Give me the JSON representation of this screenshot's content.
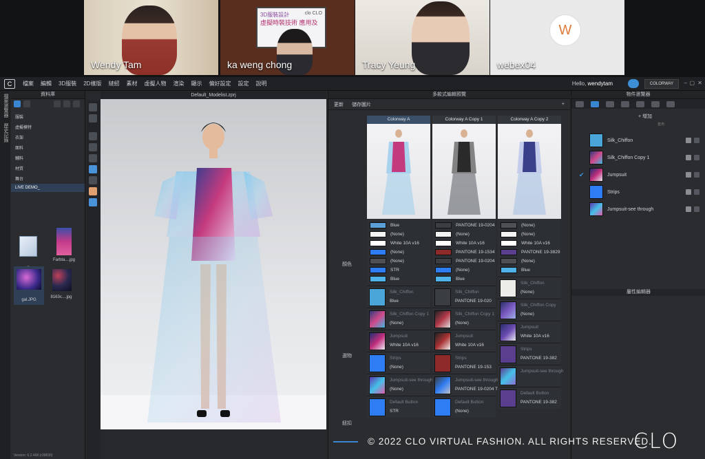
{
  "meeting": {
    "participants": [
      {
        "name": "Wendy Tam"
      },
      {
        "name": "ka weng chong",
        "slide": {
          "title": "3D服裝設計",
          "subtitle": "虛擬時裝技術 應用及",
          "logo": "clo CLO"
        }
      },
      {
        "name": "Tracy Yeung"
      },
      {
        "name": "webex04",
        "initial": "W"
      }
    ]
  },
  "app": {
    "logo": "C",
    "menu": [
      "檔案",
      "編輯",
      "3D服裝",
      "2D樣版",
      "縫紉",
      "素材",
      "虛擬人物",
      "渲染",
      "顯示",
      "偏好設定",
      "設定",
      "說明"
    ],
    "greeting_prefix": "Hello, ",
    "username": "wendytam",
    "colorway_tab": "COLORWAY",
    "window_controls": [
      "–",
      "▢",
      "✕"
    ],
    "version": "Version: 6.2.468 (r39830)"
  },
  "left_tabs": [
    "檔案瀏覽器",
    "歷史記錄"
  ],
  "library": {
    "title": "資料庫",
    "items": [
      "服裝",
      "虛擬模特",
      "衣架",
      "面料",
      "輔料",
      "材質",
      "舞台",
      "LIVE DEMO_"
    ],
    "selected_index": 7,
    "files": [
      {
        "label": "..",
        "kind": "folder"
      },
      {
        "label": "Farbta....jpg"
      },
      {
        "label": "gal.JPG"
      },
      {
        "label": "8163c....jpg"
      }
    ]
  },
  "viewport": {
    "title": "Default_Modelist.zprj"
  },
  "editor": {
    "title": "多款式編輯預覽",
    "toolbar": [
      "更新",
      "儲存圖片"
    ],
    "plus": "+",
    "row_labels": {
      "color": "顏色",
      "fabric": "選物",
      "trim": "鈕扣"
    },
    "columns": [
      {
        "name": "Colorway A",
        "swatches": [
          {
            "color": "#5aa0d6",
            "label": "Blue"
          },
          {
            "color": "#f4f4f4",
            "label": "(None)"
          },
          {
            "color": "#ffffff",
            "label": "White 10A v16"
          },
          {
            "color": "#2f7df4",
            "label": "(None)"
          },
          {
            "color": "#4d5156",
            "label": "(None)"
          },
          {
            "color": "#2f7df4",
            "label": "STR"
          },
          {
            "color": "#4fb2e8",
            "label": "Blue"
          }
        ],
        "fabrics": [
          {
            "color": "#4aa6d8",
            "name": "Silk_Chiffon",
            "value": "Blue"
          },
          {
            "color": "linear-gradient(135deg,#2e3a7a,#d04a8a,#3fb5e0)",
            "name": "Silk_Chiffon Copy 1",
            "value": "(None)"
          },
          {
            "color": "linear-gradient(135deg,#1f2f70,#c02e7c,#e9e9f2)",
            "name": "Jumpsuit",
            "value": "White 10A v16"
          },
          {
            "color": "#2f7df4",
            "name": "Strips",
            "value": "(None)"
          },
          {
            "color": "linear-gradient(135deg,#5a3ab0,#46c0e8,#e05aa8)",
            "name": "Jumpsuit-see through",
            "value": "(None)"
          },
          {
            "color": "#2f7df4",
            "name": "Default Button",
            "value": "STR"
          }
        ]
      },
      {
        "name": "Colorway A Copy 1",
        "swatches": [
          {
            "color": "#3a3d42",
            "label": "PANTONE 19-0204"
          },
          {
            "color": "#f4f4f4",
            "label": "(None)"
          },
          {
            "color": "#ffffff",
            "label": "White 10A v16"
          },
          {
            "color": "#8e2a2a",
            "label": "PANTONE 19-1534"
          },
          {
            "color": "#3a3d42",
            "label": "PANTONE 19-0204"
          },
          {
            "color": "#2f7df4",
            "label": "(None)"
          },
          {
            "color": "#4fb2e8",
            "label": "Blue"
          }
        ],
        "fabrics": [
          {
            "color": "#3a3d42",
            "name": "Silk_Chiffon",
            "value": "PANTONE 19-020"
          },
          {
            "color": "linear-gradient(135deg,#222,#b23a4a,#ddd)",
            "name": "Silk_Chiffon Copy 1",
            "value": "(None)"
          },
          {
            "color": "linear-gradient(135deg,#222,#a33,#eee)",
            "name": "Jumpsuit",
            "value": "White 10A v16"
          },
          {
            "color": "#8e2a2a",
            "name": "Strips",
            "value": "PANTONE 19-153"
          },
          {
            "color": "linear-gradient(135deg,#3a3d42,#2f7df4,#c0c0c8)",
            "name": "Jumpsuit-see through",
            "value": "PANTONE 19-0204 TI"
          },
          {
            "color": "#2f7df4",
            "name": "Default Button",
            "value": "(None)"
          }
        ]
      },
      {
        "name": "Colorway A Copy 2",
        "swatches": [
          {
            "color": "#4d5156",
            "label": "(None)"
          },
          {
            "color": "#f4f4f4",
            "label": "(None)"
          },
          {
            "color": "#ffffff",
            "label": "White 10A v16"
          },
          {
            "color": "#5a3f8e",
            "label": "PANTONE 19-3829"
          },
          {
            "color": "#4d5156",
            "label": "(None)"
          },
          {
            "color": "#4fb2e8",
            "label": "Blue"
          }
        ],
        "fabrics": [
          {
            "color": "#ecece8",
            "name": "Silk_Chiffon",
            "value": "(None)"
          },
          {
            "color": "linear-gradient(135deg,#2a2f6a,#7a5ac0,#9fb0e8)",
            "name": "Silk_Chiffon Copy",
            "value": "(None)"
          },
          {
            "color": "linear-gradient(135deg,#2a2f6a,#6a4ab0,#e8e8f0)",
            "name": "Jumpsuit",
            "value": "White 10A v16"
          },
          {
            "color": "#5a3f8e",
            "name": "Strips",
            "value": "PANTONE 19-382"
          },
          {
            "color": "linear-gradient(135deg,#5a3f8e,#46c0e8,#8a70d0)",
            "name": "Jumpsuit-see through",
            "value": ""
          },
          {
            "color": "#5a3f8e",
            "name": "Default Button",
            "value": "PANTONE 19-382"
          }
        ]
      }
    ]
  },
  "object_browser": {
    "title": "物件瀏覽器",
    "add_label": "+ 增加",
    "tools_label": "套用",
    "items": [
      {
        "name": "Silk_Chiffon",
        "color": "#4aa6d8",
        "checked": false
      },
      {
        "name": "Silk_Chiffon Copy 1",
        "color": "linear-gradient(135deg,#2e3a7a,#d04a8a,#3fb5e0)",
        "checked": false
      },
      {
        "name": "Jumpsuit",
        "color": "linear-gradient(135deg,#1f2f70,#c02e7c,#e9e9f2)",
        "checked": true
      },
      {
        "name": "Strips",
        "color": "#2f7df4",
        "checked": false
      },
      {
        "name": "Jumpsuit-see through",
        "color": "linear-gradient(135deg,#5a3ab0,#46c0e8,#e05aa8)",
        "checked": false
      }
    ],
    "properties_title": "屬性編輯器"
  },
  "footer": {
    "copyright": "© 2022 CLO VIRTUAL FASHION. ALL RIGHTS RESERVED.",
    "brand_logo": "CLO"
  },
  "colors": {
    "accent": "#3a86d1",
    "panel": "#2a2c30",
    "menubar": "#202124"
  }
}
